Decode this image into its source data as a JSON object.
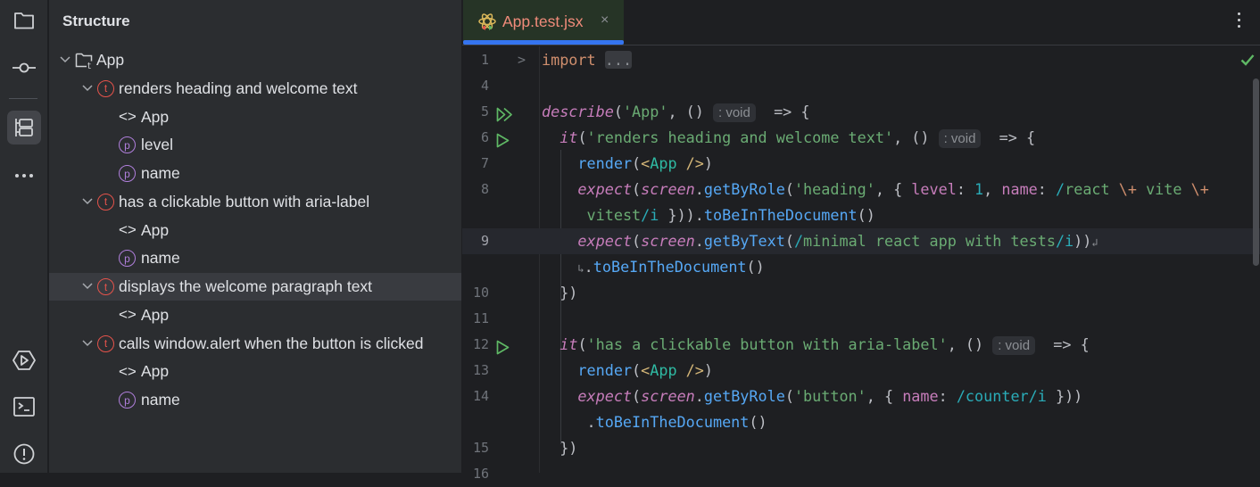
{
  "sidebar_strip": {
    "top_icons": [
      "folder-icon",
      "commit-icon",
      "structure-icon",
      "more-icon"
    ],
    "bottom_icons": [
      "run-icon",
      "terminal-icon",
      "problems-icon"
    ]
  },
  "structure": {
    "title": "Structure",
    "items": [
      {
        "level": 0,
        "kind": "suite",
        "label": "App",
        "expanded": true
      },
      {
        "level": 1,
        "kind": "test",
        "label": "renders heading and welcome text",
        "expanded": true
      },
      {
        "level": 2,
        "kind": "component",
        "label": "App"
      },
      {
        "level": 2,
        "kind": "property",
        "label": "level"
      },
      {
        "level": 2,
        "kind": "property",
        "label": "name"
      },
      {
        "level": 1,
        "kind": "test",
        "label": "has a clickable button with aria-label",
        "expanded": true
      },
      {
        "level": 2,
        "kind": "component",
        "label": "App"
      },
      {
        "level": 2,
        "kind": "property",
        "label": "name"
      },
      {
        "level": 1,
        "kind": "test",
        "label": "displays the welcome paragraph text",
        "expanded": true,
        "selected": true
      },
      {
        "level": 2,
        "kind": "component",
        "label": "App"
      },
      {
        "level": 1,
        "kind": "test",
        "label": "calls window.alert when the button is clicked",
        "expanded": true
      },
      {
        "level": 2,
        "kind": "component",
        "label": "App"
      },
      {
        "level": 2,
        "kind": "property",
        "label": "name"
      }
    ],
    "icon_text": {
      "test": "t",
      "property": "p",
      "component": "<>",
      "suite_badge": "t"
    }
  },
  "editor": {
    "tab": {
      "label": "App.test.jsx",
      "close": "×"
    },
    "status": "no-problems",
    "lines": [
      {
        "num": "1",
        "fold": ">",
        "tokens": [
          [
            "kw",
            "import"
          ],
          [
            "pl",
            " "
          ],
          [
            "fold-dots",
            "..."
          ]
        ]
      },
      {
        "num": "4",
        "tokens": []
      },
      {
        "num": "5",
        "run": "double",
        "tokens": [
          [
            "fn",
            "describe"
          ],
          [
            "pl",
            "("
          ],
          [
            "str",
            "'App'"
          ],
          [
            "pl",
            ", () "
          ],
          [
            "hint",
            ": void"
          ],
          [
            "pl",
            "  => {"
          ]
        ]
      },
      {
        "num": "6",
        "run": "single",
        "tokens": [
          [
            "pl",
            "  "
          ],
          [
            "fn",
            "it"
          ],
          [
            "pl",
            "("
          ],
          [
            "str",
            "'renders heading and welcome text'"
          ],
          [
            "pl",
            ", () "
          ],
          [
            "hint",
            ": void"
          ],
          [
            "pl",
            "  => {"
          ]
        ]
      },
      {
        "num": "7",
        "tokens": [
          [
            "pl",
            "    "
          ],
          [
            "mth",
            "render"
          ],
          [
            "pl",
            "("
          ],
          [
            "tag",
            "<"
          ],
          [
            "cmp",
            "App"
          ],
          [
            "tag",
            " />"
          ],
          [
            "pl",
            ")"
          ]
        ]
      },
      {
        "num": "8",
        "tokens": [
          [
            "pl",
            "    "
          ],
          [
            "fn",
            "expect"
          ],
          [
            "pl",
            "("
          ],
          [
            "fn",
            "screen"
          ],
          [
            "pl",
            "."
          ],
          [
            "mth",
            "getByRole"
          ],
          [
            "pl",
            "("
          ],
          [
            "str",
            "'heading'"
          ],
          [
            "pl",
            ", { "
          ],
          [
            "prop",
            "level"
          ],
          [
            "pl",
            ": "
          ],
          [
            "num",
            "1"
          ],
          [
            "pl",
            ", "
          ],
          [
            "prop",
            "name"
          ],
          [
            "pl",
            ": "
          ],
          [
            "rx",
            "/"
          ],
          [
            "rxt",
            "react "
          ],
          [
            "esc",
            "\\+"
          ],
          [
            "rxt",
            " vite "
          ],
          [
            "esc",
            "\\+"
          ]
        ]
      },
      {
        "num": "",
        "tokens": [
          [
            "pl",
            "     "
          ],
          [
            "rxt",
            "vitest"
          ],
          [
            "rx",
            "/i"
          ],
          [
            "pl",
            " }))."
          ],
          [
            "mth",
            "toBeInTheDocument"
          ],
          [
            "pl",
            "()"
          ]
        ]
      },
      {
        "num": "9",
        "current": true,
        "tokens": [
          [
            "pl",
            "    "
          ],
          [
            "fn",
            "expect"
          ],
          [
            "pl",
            "("
          ],
          [
            "fn",
            "screen"
          ],
          [
            "pl",
            "."
          ],
          [
            "mth",
            "getByText"
          ],
          [
            "pl",
            "("
          ],
          [
            "rx",
            "/"
          ],
          [
            "rxt",
            "minimal react app with tests"
          ],
          [
            "rx",
            "/i"
          ],
          [
            "pl",
            "))"
          ],
          [
            "wrap",
            "↲"
          ]
        ]
      },
      {
        "num": "",
        "tokens": [
          [
            "pl",
            "    "
          ],
          [
            "wrap",
            "↳"
          ],
          [
            "pl",
            "."
          ],
          [
            "mth",
            "toBeInTheDocument"
          ],
          [
            "pl",
            "()"
          ]
        ]
      },
      {
        "num": "10",
        "tokens": [
          [
            "pl",
            "  })"
          ]
        ]
      },
      {
        "num": "11",
        "tokens": []
      },
      {
        "num": "12",
        "run": "single",
        "tokens": [
          [
            "pl",
            "  "
          ],
          [
            "fn",
            "it"
          ],
          [
            "pl",
            "("
          ],
          [
            "str",
            "'has a clickable button with aria-label'"
          ],
          [
            "pl",
            ", () "
          ],
          [
            "hint",
            ": void"
          ],
          [
            "pl",
            "  => {"
          ]
        ]
      },
      {
        "num": "13",
        "tokens": [
          [
            "pl",
            "    "
          ],
          [
            "mth",
            "render"
          ],
          [
            "pl",
            "("
          ],
          [
            "tag",
            "<"
          ],
          [
            "cmp",
            "App"
          ],
          [
            "tag",
            " />"
          ],
          [
            "pl",
            ")"
          ]
        ]
      },
      {
        "num": "14",
        "tokens": [
          [
            "pl",
            "    "
          ],
          [
            "fn",
            "expect"
          ],
          [
            "pl",
            "("
          ],
          [
            "fn",
            "screen"
          ],
          [
            "pl",
            "."
          ],
          [
            "mth",
            "getByRole"
          ],
          [
            "pl",
            "("
          ],
          [
            "str",
            "'button'"
          ],
          [
            "pl",
            ", { "
          ],
          [
            "prop",
            "name"
          ],
          [
            "pl",
            ": "
          ],
          [
            "rx",
            "/counter/i"
          ],
          [
            "pl",
            " }))"
          ]
        ]
      },
      {
        "num": "",
        "tokens": [
          [
            "pl",
            "     ."
          ],
          [
            "mth",
            "toBeInTheDocument"
          ],
          [
            "pl",
            "()"
          ]
        ]
      },
      {
        "num": "15",
        "tokens": [
          [
            "pl",
            "  })"
          ]
        ]
      },
      {
        "num": "16",
        "tokens": []
      }
    ]
  },
  "colors": {
    "accent": "#3574f0",
    "run": "#5fb865",
    "test_badge": "#e5534b",
    "property_badge": "#b07fdc",
    "check": "#5fb865"
  }
}
